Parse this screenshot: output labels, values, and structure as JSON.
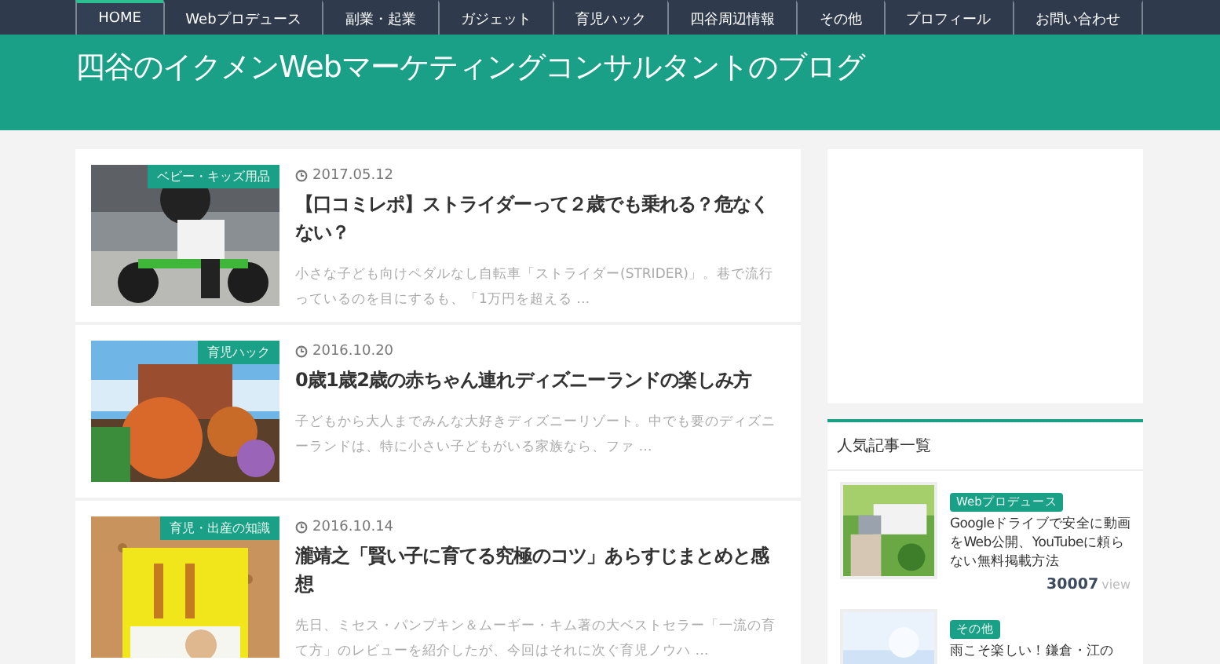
{
  "nav": [
    {
      "label": "HOME",
      "selected": true
    },
    {
      "label": "Webプロデュース",
      "selected": false
    },
    {
      "label": "副業・起業",
      "selected": false
    },
    {
      "label": "ガジェット",
      "selected": false
    },
    {
      "label": "育児ハック",
      "selected": false
    },
    {
      "label": "四谷周辺情報",
      "selected": false
    },
    {
      "label": "その他",
      "selected": false
    },
    {
      "label": "プロフィール",
      "selected": false
    },
    {
      "label": "お問い合わせ",
      "selected": false
    }
  ],
  "site_title": "四谷のイクメンWebマーケティングコンサルタントのブログ",
  "posts": [
    {
      "category": "ベビー・キッズ用品",
      "date": "2017.05.12",
      "title": "【口コミレポ】ストライダーって２歳でも乗れる？危なくない？",
      "excerpt": "小さな子ども向けペダルなし自転車「ストライダー(STRIDER)」。巷で流行っているのを目にするも、「1万円を超える …"
    },
    {
      "category": "育児ハック",
      "date": "2016.10.20",
      "title": "0歳1歳2歳の赤ちゃん連れディズニーランドの楽しみ方",
      "excerpt": "子どもから大人までみんな大好きディズニーリゾート。中でも要のディズニーランドは、特に小さい子どもがいる家族なら、ファ …"
    },
    {
      "category": "育児・出産の知識",
      "date": "2016.10.14",
      "title": "瀧靖之「賢い子に育てる究極のコツ」あらすじまとめと感想",
      "excerpt": "先日、ミセス・パンプキン＆ムーギー・キム著の大ベストセラー「一流の育て方」のレビューを紹介したが、今回はそれに次ぐ育児ノウハ …"
    }
  ],
  "sidebar": {
    "widget_title": "人気記事一覧",
    "popular": [
      {
        "category": "Webプロデュース",
        "title": "Googleドライブで安全に動画をWeb公開、YouTubeに頼らない無料掲載方法",
        "views": "30007",
        "views_unit": "view"
      },
      {
        "category": "その他",
        "title": "雨こそ楽しい！鎌倉・江の"
      }
    ]
  }
}
